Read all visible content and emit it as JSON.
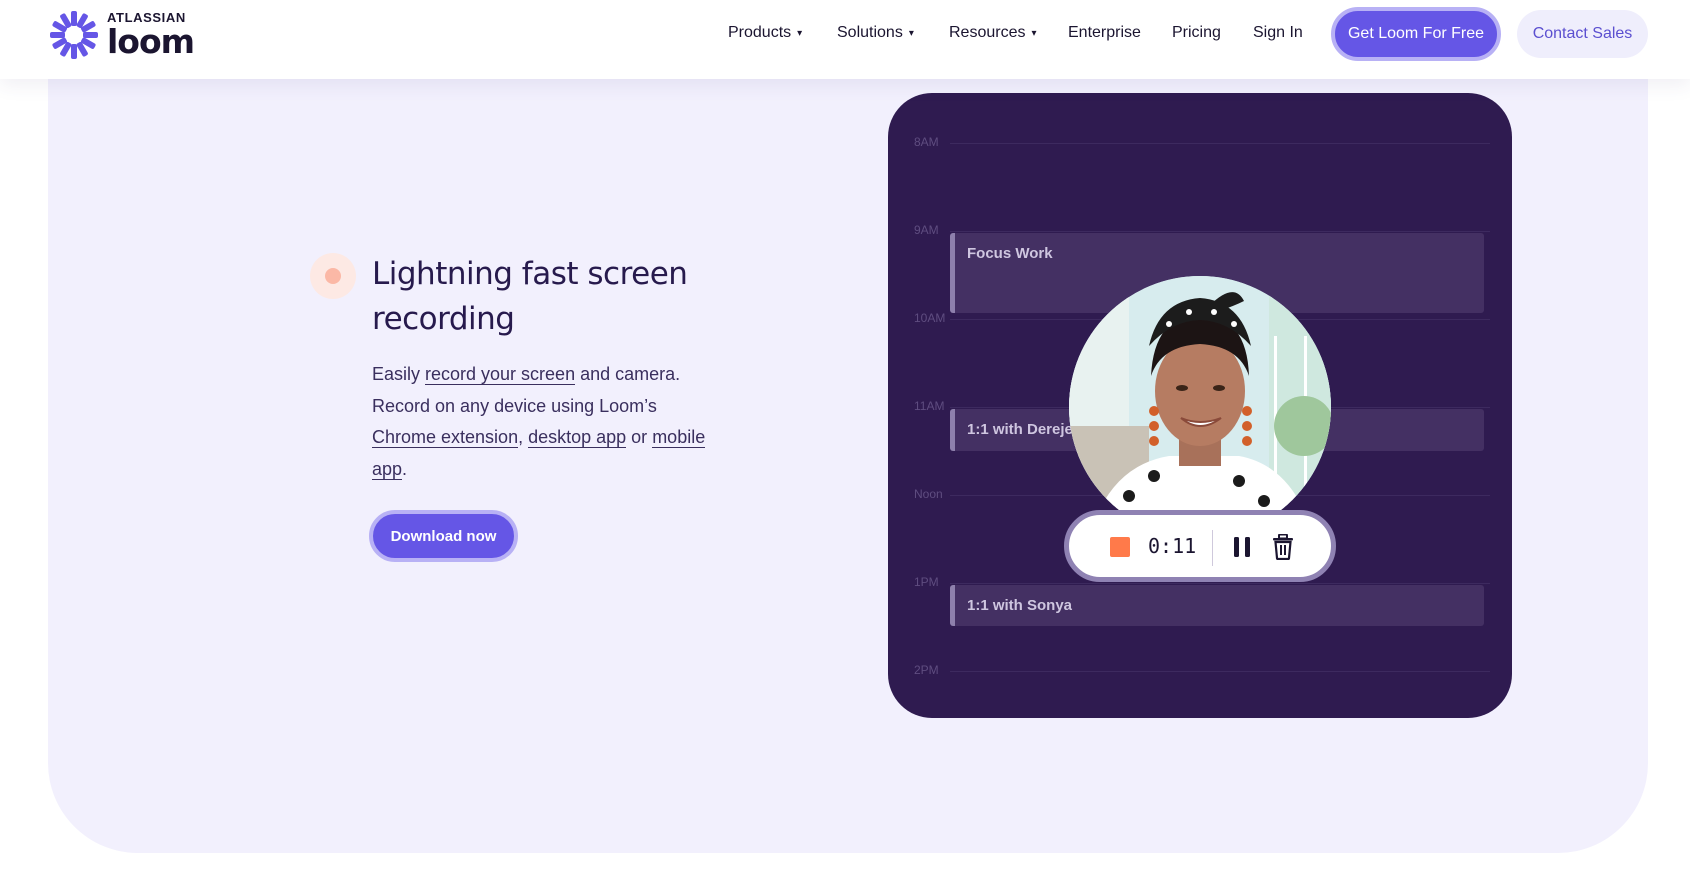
{
  "brand": {
    "company": "ATLASSIAN",
    "product": "loom",
    "color": "#6556e6"
  },
  "nav": {
    "items": [
      {
        "label": "Products",
        "caret": "▾"
      },
      {
        "label": "Solutions",
        "caret": "▾"
      },
      {
        "label": "Resources",
        "caret": "▾"
      },
      {
        "label": "Enterprise",
        "caret": ""
      },
      {
        "label": "Pricing",
        "caret": ""
      },
      {
        "label": "Sign In",
        "caret": ""
      }
    ],
    "cta_primary": "Get Loom For Free",
    "cta_secondary": "Contact Sales"
  },
  "feature": {
    "heading": "Lightning fast screen recording",
    "para_text": {
      "t1": "Easily ",
      "link1": "record your screen",
      "t2": " and camera. Record on any device using Loom’s ",
      "link2": "Chrome extension",
      "t3": ", ",
      "link3": "desktop app",
      "t4": " or ",
      "link4": "mobile app",
      "t5": "."
    },
    "button": "Download now"
  },
  "calendar": {
    "hours": [
      "8AM",
      "9AM",
      "10AM",
      "11AM",
      "Noon",
      "1PM",
      "2PM"
    ],
    "events": [
      "Focus Work",
      "1:1 with Dereje",
      "1:1 with Sonya"
    ]
  },
  "recorder": {
    "time": "0:11",
    "stop_icon": "stop-icon",
    "pause_icon": "pause-icon",
    "delete_icon": "trash-icon"
  }
}
